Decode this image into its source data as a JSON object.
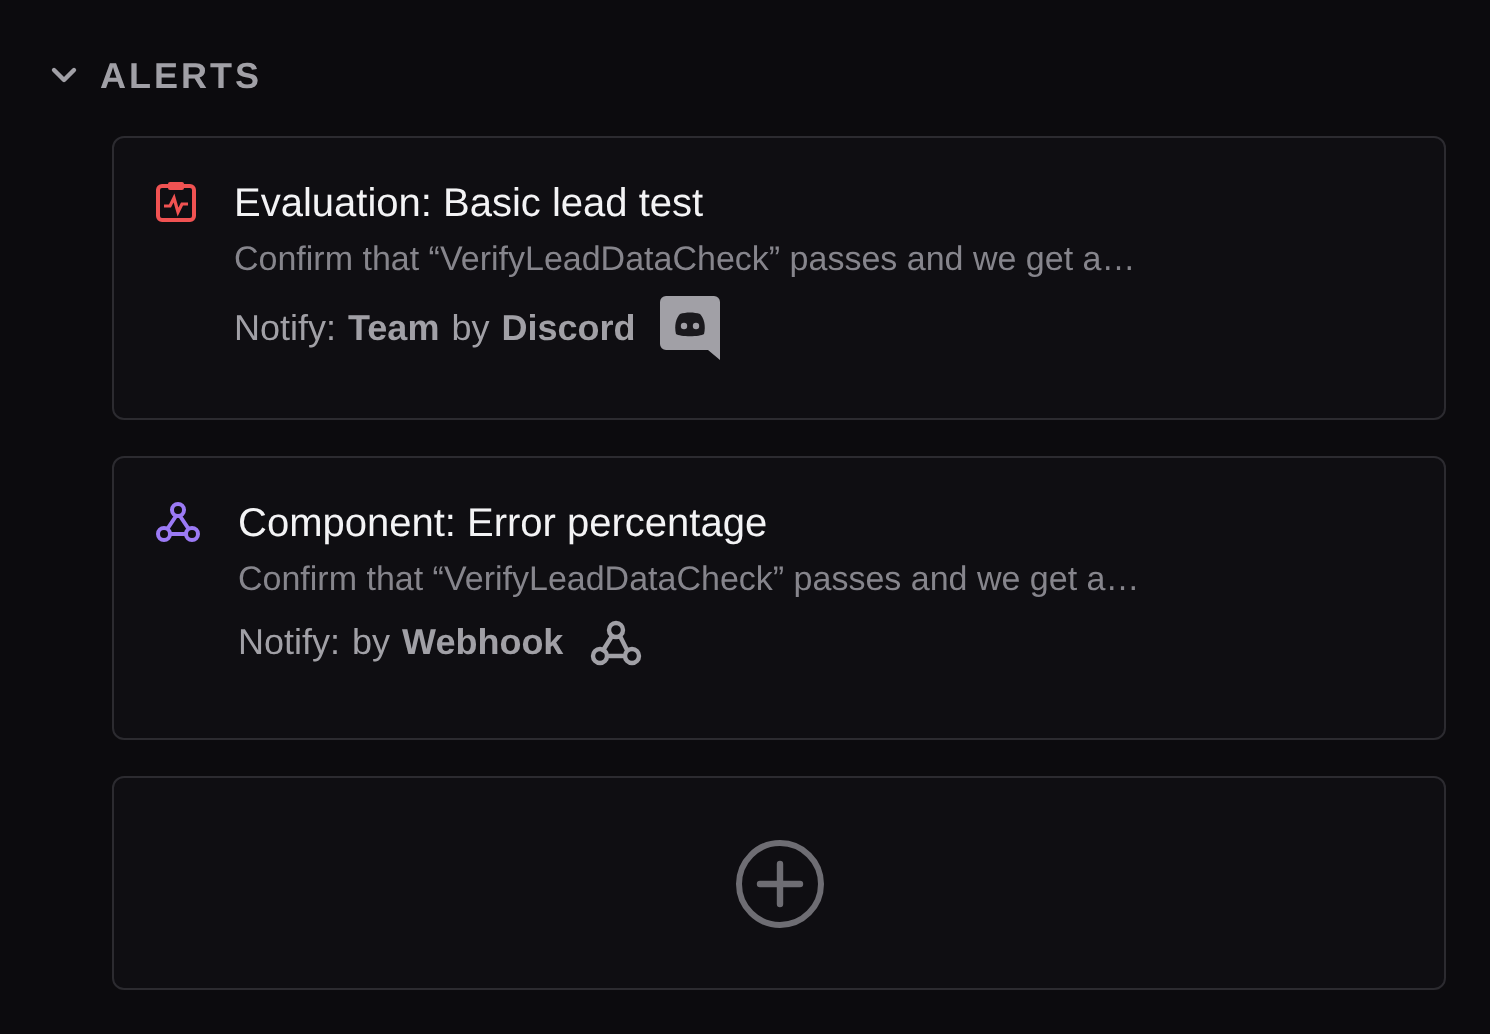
{
  "section": {
    "title": "ALERTS",
    "expanded": true
  },
  "alerts": [
    {
      "kind": "evaluation",
      "title": "Evaluation: Basic lead test",
      "description": "Confirm that “VerifyLeadDataCheck” passes and we get a…",
      "notify_label": "Notify:",
      "target": "Team",
      "by": "by",
      "channel": {
        "kind": "discord",
        "label": "Discord"
      }
    },
    {
      "kind": "component",
      "title": "Component: Error percentage",
      "description": "Confirm that “VerifyLeadDataCheck” passes and we get a…",
      "notify_label": "Notify:",
      "by": "by",
      "channel": {
        "kind": "webhook",
        "label": "Webhook"
      }
    }
  ]
}
